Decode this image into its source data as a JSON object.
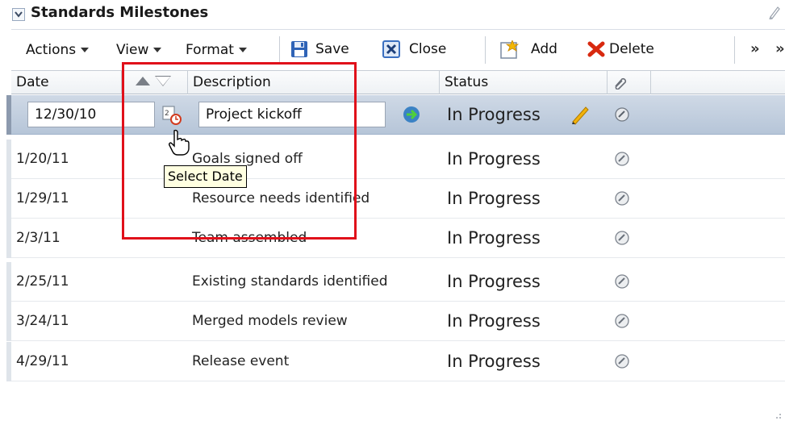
{
  "panel": {
    "title": "Standards Milestones"
  },
  "toolbar": {
    "actions_label": "Actions",
    "view_label": "View",
    "format_label": "Format",
    "save_label": "Save",
    "close_label": "Close",
    "add_label": "Add",
    "delete_label": "Delete",
    "overflow_label": "»"
  },
  "table": {
    "headers": {
      "date": "Date",
      "description": "Description",
      "status": "Status"
    },
    "rows": [
      {
        "date": "12/30/10",
        "description": "Project kickoff",
        "status": "In Progress"
      },
      {
        "date": "1/20/11",
        "description": "Goals signed off",
        "status": "In Progress"
      },
      {
        "date": "1/29/11",
        "description": "Resource needs identified",
        "status": "In Progress"
      },
      {
        "date": "2/3/11",
        "description": "Team assembled",
        "status": "In Progress"
      },
      {
        "date": "2/25/11",
        "description": "Existing standards identified",
        "status": "In Progress"
      },
      {
        "date": "3/24/11",
        "description": "Merged models review",
        "status": "In Progress"
      },
      {
        "date": "4/29/11",
        "description": "Release event",
        "status": "In Progress"
      }
    ]
  },
  "tooltip": {
    "text": "Select Date"
  },
  "colors": {
    "highlight": "#e0101a",
    "selected_row": "#b6c5d8",
    "tooltip_bg": "#ffffe1"
  }
}
